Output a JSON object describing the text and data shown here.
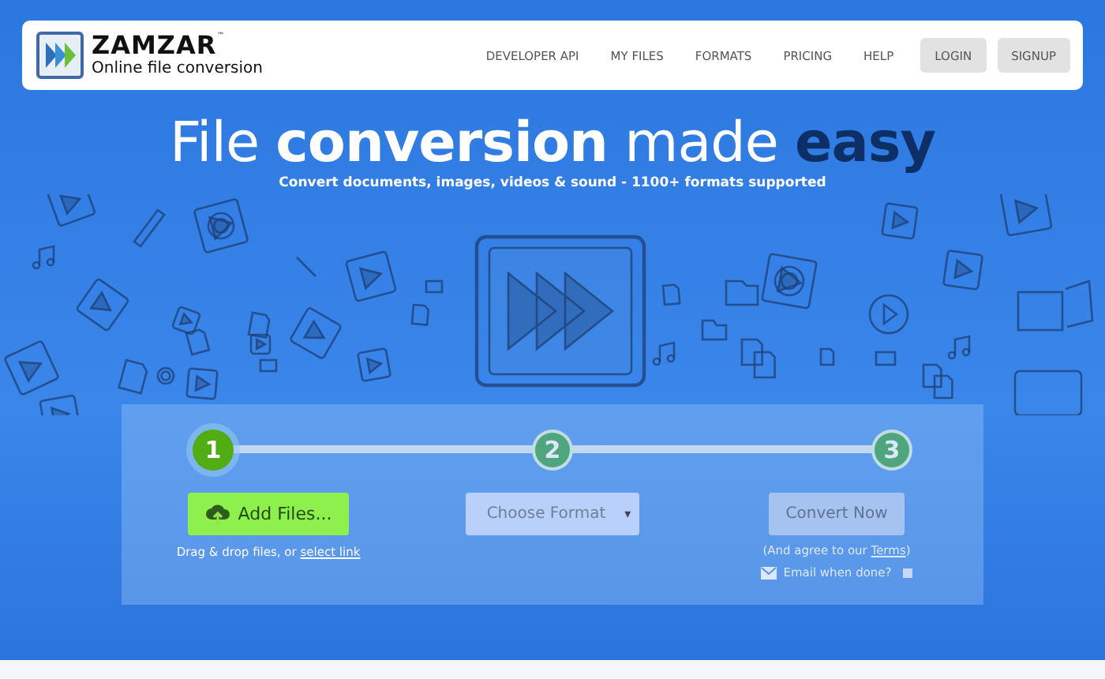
{
  "header": {
    "logo_name": "ZAMZAR",
    "logo_mark": "™",
    "tagline": "Online file conversion",
    "nav": [
      {
        "label": "DEVELOPER API",
        "kind": "link"
      },
      {
        "label": "MY FILES",
        "kind": "link"
      },
      {
        "label": "FORMATS",
        "kind": "link"
      },
      {
        "label": "PRICING",
        "kind": "link"
      },
      {
        "label": "HELP",
        "kind": "link"
      },
      {
        "label": "LOGIN",
        "kind": "button"
      },
      {
        "label": "SIGNUP",
        "kind": "button"
      }
    ]
  },
  "hero": {
    "title": "File **conversion** made **easy**",
    "subtitle": "Convert documents, images, videos & sound - 1100+ formats supported"
  },
  "steps": [
    {
      "number": "1",
      "selected": true
    },
    {
      "number": "2",
      "selected": false
    },
    {
      "number": "3",
      "selected": false
    }
  ],
  "add_files": {
    "label": "Add Files...",
    "hint": "Drag & drop files, or ",
    "link": "select link"
  },
  "format": {
    "label": "Choose Format",
    "caret": "▾"
  },
  "convert": {
    "label": "Convert Now",
    "note_before": "(And agree to our ",
    "note_link": "Terms",
    "note_after": ")",
    "email_label": "Email when done?",
    "email_checked": false
  }
}
